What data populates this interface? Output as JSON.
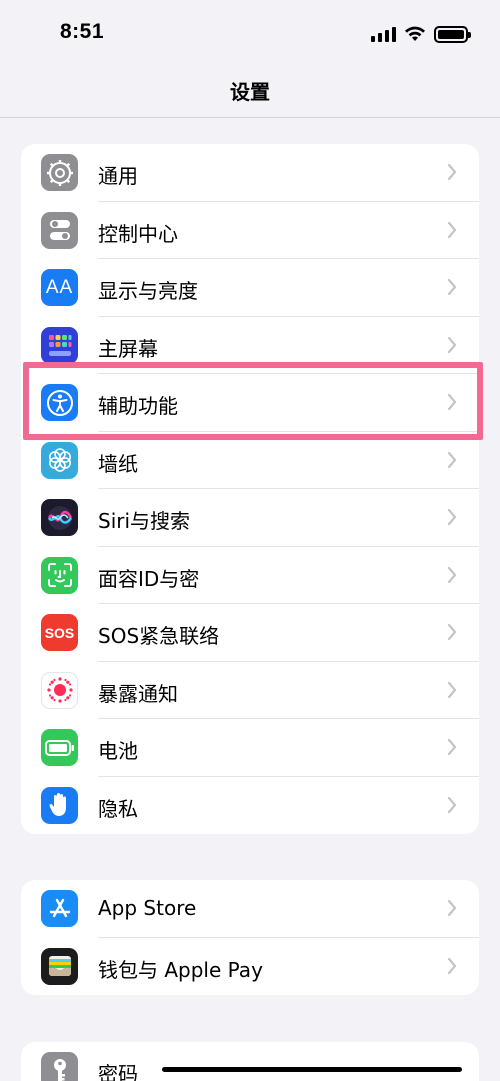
{
  "status_bar": {
    "time": "8:51"
  },
  "nav": {
    "title": "设置"
  },
  "group1": [
    {
      "label": "通用",
      "icon": "gear-icon",
      "color": "#8e8e93"
    },
    {
      "label": "控制中心",
      "icon": "toggles-icon",
      "color": "#8e8e93"
    },
    {
      "label": "显示与亮度",
      "icon": "text-size-icon",
      "color": "#1a7cf5"
    },
    {
      "label": "主屏幕",
      "icon": "home-screen-grid-icon",
      "color": "#2f3fd8"
    },
    {
      "label": "辅助功能",
      "icon": "accessibility-icon",
      "color": "#1a7cf5"
    },
    {
      "label": "墙纸",
      "icon": "flower-icon",
      "color": "#35aadc"
    },
    {
      "label": "Siri与搜索",
      "icon": "siri-icon",
      "color": "#1b1b2b"
    },
    {
      "label": "面容ID与密",
      "icon": "face-id-icon",
      "color": "#34c759"
    },
    {
      "label": "SOS紧急联络",
      "icon": "sos-icon",
      "color": "#ef3b2d",
      "icon_text": "SOS"
    },
    {
      "label": "暴露通知",
      "icon": "exposure-icon",
      "color": "#ffffff"
    },
    {
      "label": "电池",
      "icon": "battery-icon",
      "color": "#34c759"
    },
    {
      "label": "隐私",
      "icon": "hand-icon",
      "color": "#1a7cf5"
    }
  ],
  "group2": [
    {
      "label": "App Store",
      "icon": "app-store-icon",
      "color": "#1a8cf5"
    },
    {
      "label": "钱包与 Apple Pay",
      "icon": "wallet-icon",
      "color": "#1c1c1e"
    }
  ],
  "group3": [
    {
      "label": "密码",
      "icon": "key-icon",
      "color": "#8e8e93"
    }
  ],
  "highlight_color": "#f06a92"
}
